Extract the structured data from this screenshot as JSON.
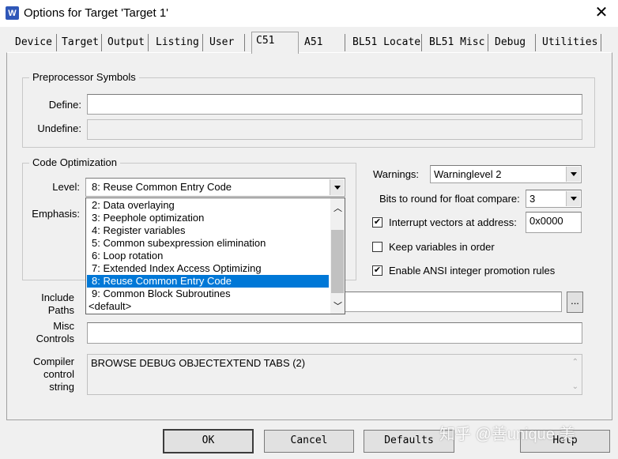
{
  "window": {
    "icon_letter": "W",
    "title": "Options for Target 'Target 1'",
    "close_glyph": "✕"
  },
  "tabs": [
    {
      "label": "Device"
    },
    {
      "label": "Target"
    },
    {
      "label": "Output"
    },
    {
      "label": "Listing"
    },
    {
      "label": "User"
    },
    {
      "label": "C51",
      "active": true
    },
    {
      "label": "A51"
    },
    {
      "label": "BL51 Locate"
    },
    {
      "label": "BL51 Misc"
    },
    {
      "label": "Debug"
    },
    {
      "label": "Utilities"
    }
  ],
  "preprocessor": {
    "legend": "Preprocessor Symbols",
    "define_label": "Define:",
    "define_value": "",
    "undefine_label": "Undefine:",
    "undefine_value": ""
  },
  "code_opt": {
    "legend": "Code Optimization",
    "level_label": "Level:",
    "level_value": "8: Reuse Common Entry Code",
    "emphasis_label": "Emphasis:",
    "level_options": [
      "2: Data overlaying",
      "3: Peephole optimization",
      "4: Register variables",
      "5: Common subexpression elimination",
      "6: Loop rotation",
      "7: Extended Index Access Optimizing",
      "8: Reuse Common Entry Code",
      "9: Common Block Subroutines",
      "<default>"
    ],
    "selected_index": 6
  },
  "right": {
    "warnings_label": "Warnings:",
    "warnings_value": "Warninglevel 2",
    "bits_label": "Bits to round for float compare:",
    "bits_value": "3",
    "interrupt_label": "Interrupt vectors at address:",
    "interrupt_checked": true,
    "interrupt_value": "0x0000",
    "keep_vars_label": "Keep variables in order",
    "keep_vars_checked": false,
    "ansi_label": "Enable ANSI integer promotion rules",
    "ansi_checked": true
  },
  "paths": {
    "include_label_1": "Include",
    "include_label_2": "Paths",
    "include_value": "",
    "browse_label": "...",
    "misc_label_1": "Misc",
    "misc_label_2": "Controls",
    "misc_value": "",
    "compiler_label_1": "Compiler",
    "compiler_label_2": "control",
    "compiler_label_3": "string",
    "compiler_value": "BROWSE DEBUG OBJECTEXTEND TABS (2)"
  },
  "buttons": {
    "ok": "OK",
    "cancel": "Cancel",
    "defaults": "Defaults",
    "help": "Help"
  },
  "watermark": "知乎 @善unique 美",
  "check_glyph": "✔",
  "colors": {
    "selection": "#0078d7",
    "app_icon": "#2f57b8"
  }
}
